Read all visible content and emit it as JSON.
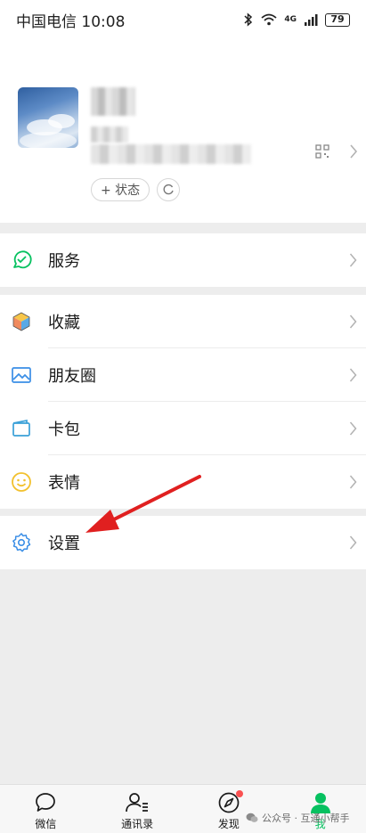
{
  "status_bar": {
    "carrier_time": "中国电信 10:08",
    "network": "4G",
    "battery": "79",
    "icons": [
      "bluetooth-icon",
      "wifi-icon",
      "signal-icon",
      "battery-icon"
    ]
  },
  "profile": {
    "status_label": "+ 状态"
  },
  "menu": {
    "service": {
      "label": "服务",
      "icon": "service-check-icon"
    },
    "favorites": {
      "label": "收藏",
      "icon": "cube-icon"
    },
    "moments": {
      "label": "朋友圈",
      "icon": "image-icon"
    },
    "cards": {
      "label": "卡包",
      "icon": "wallet-icon"
    },
    "stickers": {
      "label": "表情",
      "icon": "smile-icon"
    },
    "settings": {
      "label": "设置",
      "icon": "gear-icon"
    }
  },
  "tabbar": {
    "tabs": [
      {
        "label": "微信",
        "icon": "chat-bubble-icon"
      },
      {
        "label": "通讯录",
        "icon": "contacts-icon"
      },
      {
        "label": "发现",
        "icon": "compass-icon"
      },
      {
        "label": "我",
        "icon": "person-icon"
      }
    ],
    "active": "我"
  },
  "watermark": "公众号 · 互通小帮手",
  "colors": {
    "accent_green": "#07c160",
    "annotation_red": "#e02020",
    "badge_red": "#fa5151",
    "background": "#ededed"
  }
}
